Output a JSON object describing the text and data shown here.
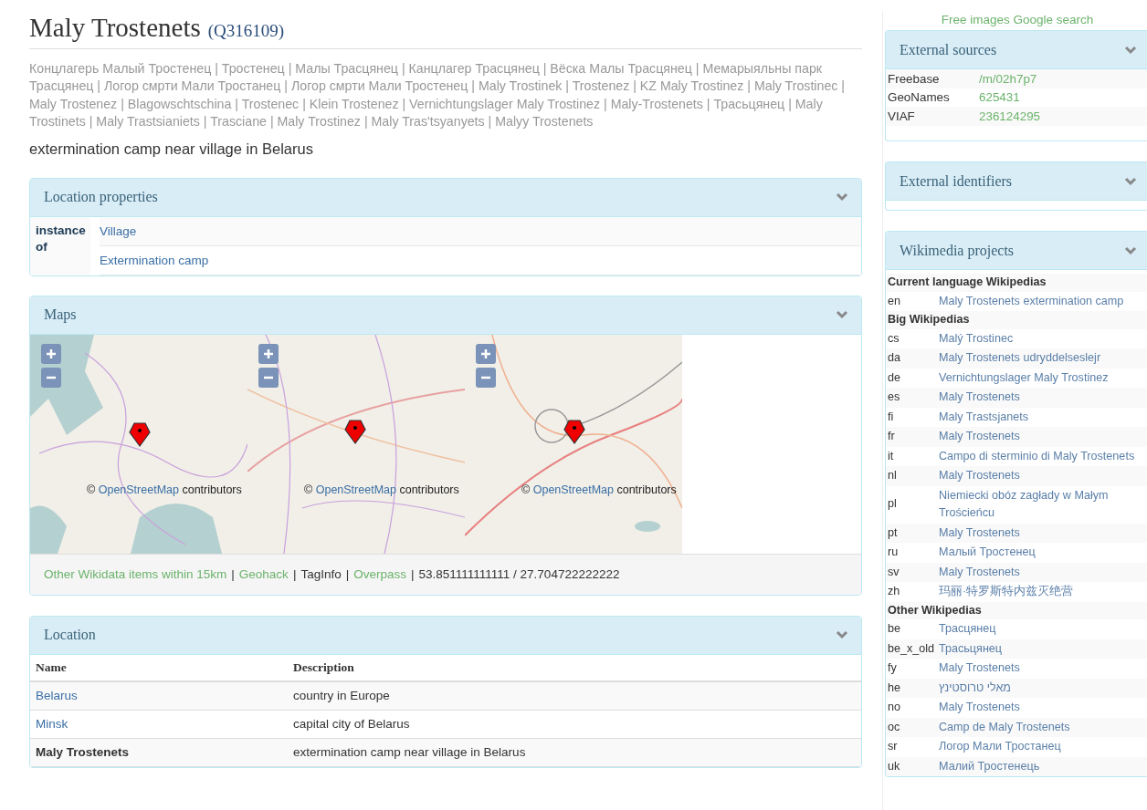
{
  "title": "Maly Trostenets",
  "qid": "(Q316109)",
  "aliases": "Концлагерь Малый Тростенец | Тростенец | Малы Трасцянец | Канцлагер Трасцянец | Вёска Малы Трасцянец | Мемарыяльны парк Трасцянец | Логор смрти Мали Тростанец | Логор смрти Мали Тростенец | Maly Trostinek | Trostenez | KZ Maly Trostinez | Maly Trostinec | Maly Trostenez | Blagowschtschina | Trostenec | Klein Trostenez | Vernichtungslager Maly Trostinez | Maly-Trostenets | Трасьцянец | Maly Trostinets | Maly Trastsianiets | Trasciane | Maly Trostinez | Maly Tras'tsyanyets | Malyy Trostenets",
  "description": "extermination camp near village in Belarus",
  "location_properties": {
    "title": "Location properties",
    "property": "instance of",
    "values": [
      "Village",
      "Extermination camp"
    ]
  },
  "maps": {
    "title": "Maps",
    "tiles": [
      {
        "attribution_prefix": "©",
        "attribution_link": "OpenStreetMap",
        "attribution_suffix": "contributors"
      },
      {
        "attribution_prefix": "©",
        "attribution_link": "OpenStreetMap",
        "attribution_suffix": "contributors"
      },
      {
        "attribution_prefix": "©",
        "attribution_link": "OpenStreetMap",
        "attribution_suffix": "contributors"
      }
    ],
    "footer": [
      {
        "kind": "link",
        "text": "Other Wikidata items within 15km"
      },
      {
        "kind": "sep",
        "text": "|"
      },
      {
        "kind": "link",
        "text": "Geohack"
      },
      {
        "kind": "sep",
        "text": "|"
      },
      {
        "kind": "plain",
        "text": "TagInfo"
      },
      {
        "kind": "sep",
        "text": "|"
      },
      {
        "kind": "link",
        "text": "Overpass"
      },
      {
        "kind": "sep",
        "text": "|"
      },
      {
        "kind": "plain",
        "text": "53.851111111111 / 27.704722222222"
      }
    ]
  },
  "location": {
    "title": "Location",
    "columns": [
      "Name",
      "Description"
    ],
    "rows": [
      {
        "name": "Belarus",
        "description": "country in Europe",
        "current": false
      },
      {
        "name": "Minsk",
        "description": "capital city of Belarus",
        "current": false
      },
      {
        "name": "Maly Trostenets",
        "description": "extermination camp near village in Belarus",
        "current": true
      }
    ]
  },
  "free_images": "Free images Google search",
  "external_sources": {
    "title": "External sources",
    "rows": [
      {
        "label": "Freebase",
        "value": "/m/02h7p7"
      },
      {
        "label": "GeoNames",
        "value": "625431"
      },
      {
        "label": "VIAF",
        "value": "236124295"
      }
    ]
  },
  "external_identifiers": {
    "title": "External identifiers"
  },
  "wikimedia": {
    "title": "Wikimedia projects",
    "rows": [
      {
        "kind": "group",
        "text": "Current language Wikipedias"
      },
      {
        "kind": "site",
        "code": "en",
        "text": "Maly Trostenets extermination camp"
      },
      {
        "kind": "group",
        "text": "Big Wikipedias"
      },
      {
        "kind": "site",
        "code": "cs",
        "text": "Malý Trostinec"
      },
      {
        "kind": "site",
        "code": "da",
        "text": "Maly Trostenets udryddelseslejr"
      },
      {
        "kind": "site",
        "code": "de",
        "text": "Vernichtungslager Maly Trostinez"
      },
      {
        "kind": "site",
        "code": "es",
        "text": "Maly Trostenets"
      },
      {
        "kind": "site",
        "code": "fi",
        "text": "Maly Trastsjanets"
      },
      {
        "kind": "site",
        "code": "fr",
        "text": "Maly Trostenets"
      },
      {
        "kind": "site",
        "code": "it",
        "text": "Campo di sterminio di Maly Trostenets"
      },
      {
        "kind": "site",
        "code": "nl",
        "text": "Maly Trostenets"
      },
      {
        "kind": "site",
        "code": "pl",
        "text": "Niemiecki obóz zagłady w Małym Trościeńcu"
      },
      {
        "kind": "site",
        "code": "pt",
        "text": "Maly Trostenets"
      },
      {
        "kind": "site",
        "code": "ru",
        "text": "Малый Тростенец"
      },
      {
        "kind": "site",
        "code": "sv",
        "text": "Maly Trostenets"
      },
      {
        "kind": "site",
        "code": "zh",
        "text": "玛丽·特罗斯特内兹灭绝营"
      },
      {
        "kind": "group",
        "text": "Other Wikipedias"
      },
      {
        "kind": "site",
        "code": "be",
        "text": "Трасцянец"
      },
      {
        "kind": "site",
        "code": "be_x_old",
        "text": "Трасьцянец"
      },
      {
        "kind": "site",
        "code": "fy",
        "text": "Maly Trostenets"
      },
      {
        "kind": "site",
        "code": "he",
        "text": "מאלי טרוסטינץ"
      },
      {
        "kind": "site",
        "code": "no",
        "text": "Maly Trostenets"
      },
      {
        "kind": "site",
        "code": "oc",
        "text": "Camp de Maly Trostenets"
      },
      {
        "kind": "site",
        "code": "sr",
        "text": "Логор Мали Тростанец"
      },
      {
        "kind": "site",
        "code": "uk",
        "text": "Малий Тростенець"
      }
    ]
  }
}
